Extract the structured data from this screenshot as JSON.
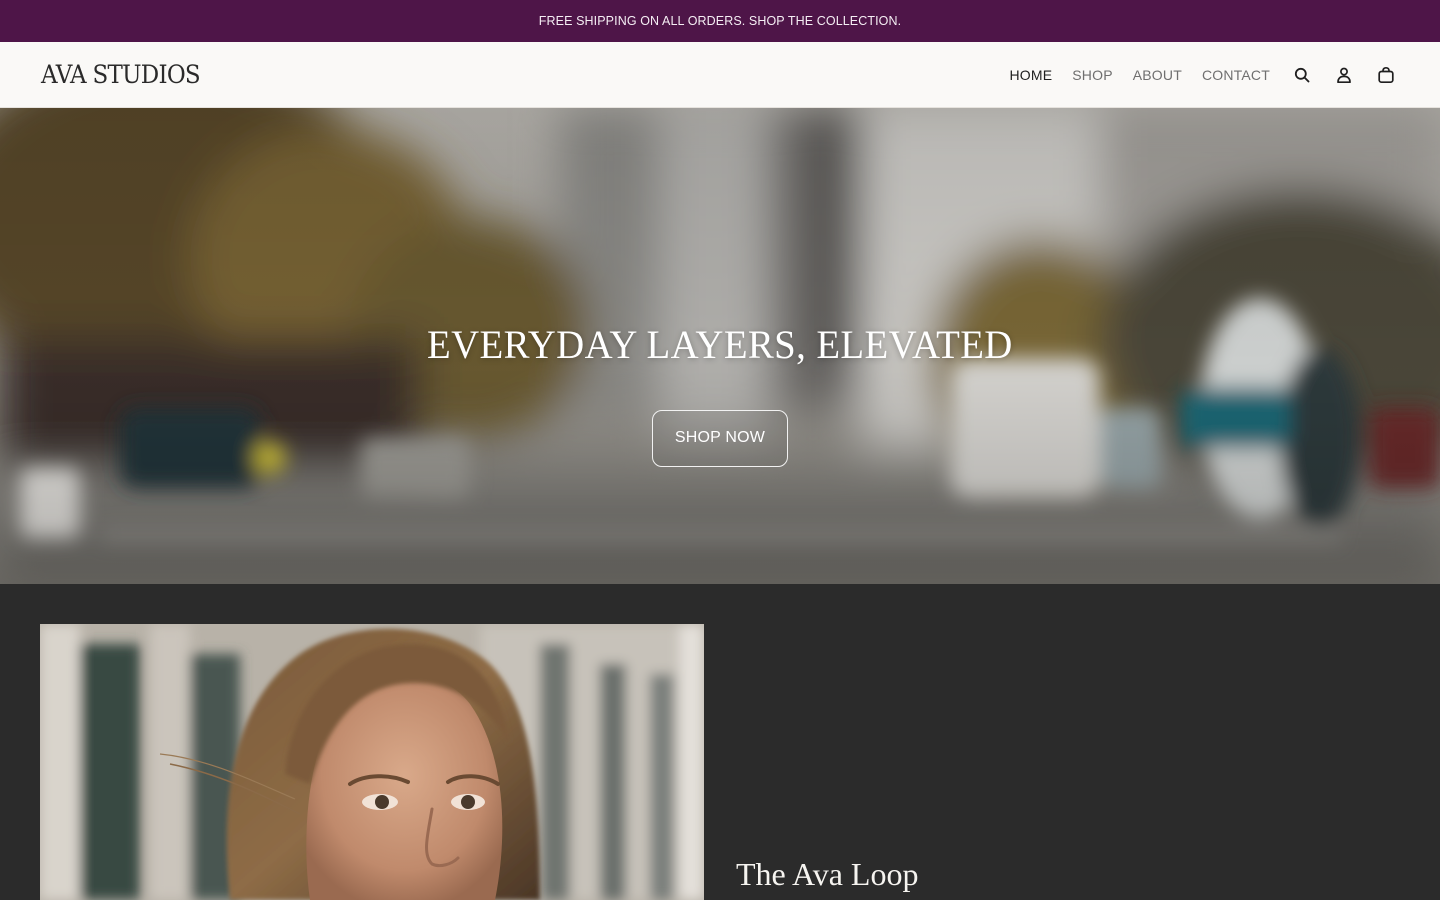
{
  "announcement": {
    "text": "FREE SHIPPING ON ALL ORDERS. SHOP THE COLLECTION."
  },
  "header": {
    "logo": "AVA STUDIOS",
    "nav": [
      {
        "label": "HOME",
        "active": true
      },
      {
        "label": "SHOP",
        "active": false
      },
      {
        "label": "ABOUT",
        "active": false
      },
      {
        "label": "CONTACT",
        "active": false
      }
    ],
    "icons": [
      "search-icon",
      "account-icon",
      "cart-icon"
    ]
  },
  "hero": {
    "title": "EVERYDAY LAYERS, ELEVATED",
    "button_label": "SHOP NOW"
  },
  "feature": {
    "title": "The Ava Loop"
  },
  "colors": {
    "announcement_bg": "#4e1548",
    "header_bg": "#faf9f7",
    "section_bg": "#2b2b2b",
    "text_dark": "#1f1f1f",
    "text_muted": "#6f6f6f"
  }
}
